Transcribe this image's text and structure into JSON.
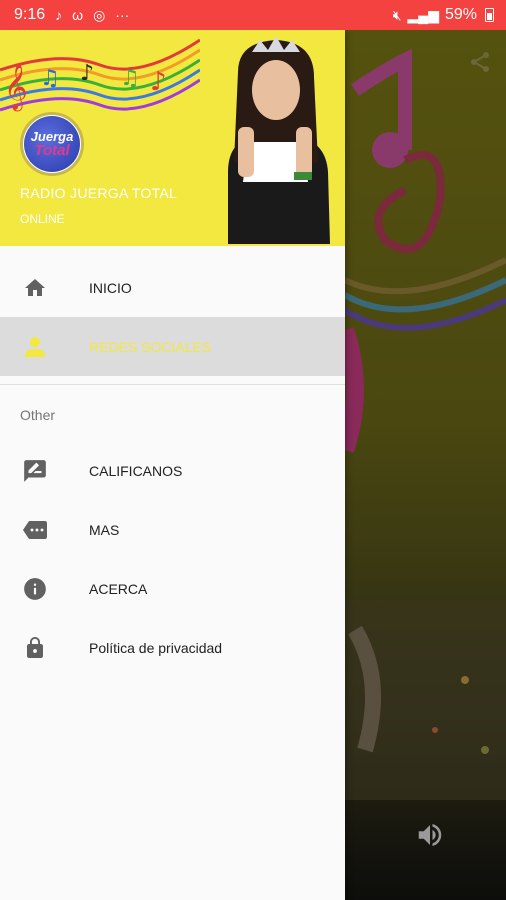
{
  "status_bar": {
    "time": "9:16",
    "battery": "59%"
  },
  "drawer": {
    "station_name": "RADIO JUERGA TOTAL",
    "station_status": "ONLINE",
    "logo_text": [
      "Juerga",
      "Total"
    ],
    "menu": [
      {
        "label": "INICIO",
        "icon": "home-icon"
      },
      {
        "label": "REDES SOCIALES",
        "icon": "person-icon",
        "active": true
      }
    ],
    "section_label": "Other",
    "other_menu": [
      {
        "label": "CALIFICANOS",
        "icon": "rate-review-icon"
      },
      {
        "label": "MAS",
        "icon": "more-tag-icon"
      },
      {
        "label": "ACERCA",
        "icon": "info-icon"
      },
      {
        "label": "Política de privacidad",
        "icon": "lock-icon"
      }
    ]
  },
  "colors": {
    "status_bar": "#f3423f",
    "header_bg": "#f2e840",
    "active_text": "#f2e840",
    "icon_gray": "#616161"
  }
}
